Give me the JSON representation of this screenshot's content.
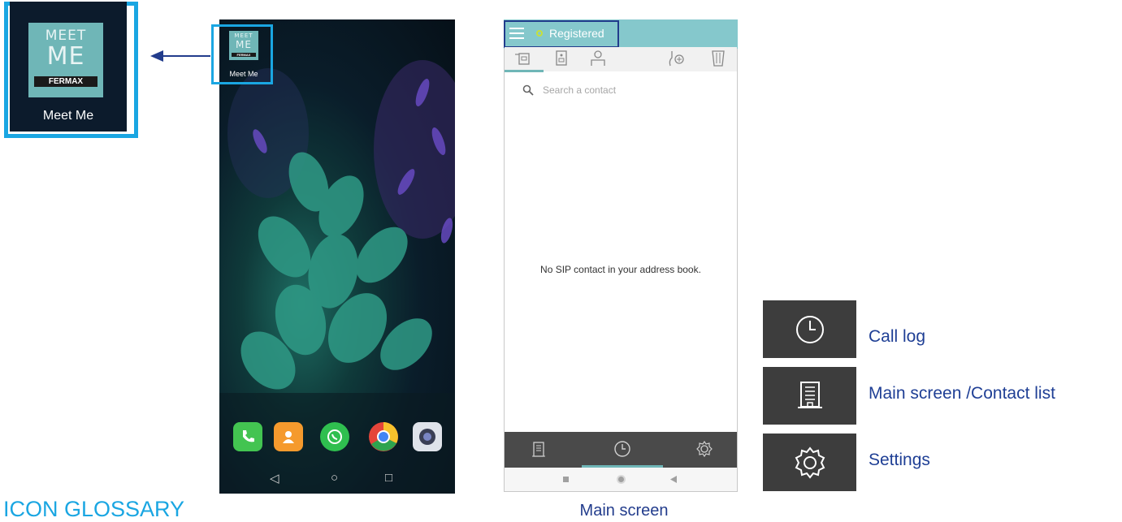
{
  "app_icon": {
    "logo_line1": "MEET",
    "logo_line2": "ME",
    "brand": "FERMAX",
    "label": "Meet Me"
  },
  "home_screen": {
    "app_label": "Meet Me",
    "dock": [
      {
        "icon": "phone-icon",
        "color": "#43c451"
      },
      {
        "icon": "contacts-icon",
        "color": "#f59a2d"
      },
      {
        "icon": "whatsapp-icon",
        "color": "#2fbf4f"
      },
      {
        "icon": "chrome-icon",
        "color": "#e5453a"
      },
      {
        "icon": "camera-icon",
        "color": "#dfe3ea"
      }
    ],
    "nav": {
      "back": "◁",
      "home": "○",
      "recents": "□"
    }
  },
  "main_screen": {
    "status": "Registered",
    "search_placeholder": "Search a contact",
    "empty_message": "No SIP contact in your address book.",
    "accent_color": "#85c8cc",
    "caption": "Main screen"
  },
  "glossary": {
    "title": "ICON GLOSSARY",
    "items": [
      {
        "icon": "clock-icon",
        "label": "Call log"
      },
      {
        "icon": "building-icon",
        "label": "Main screen /Contact list"
      },
      {
        "icon": "gear-icon",
        "label": "Settings"
      }
    ]
  }
}
